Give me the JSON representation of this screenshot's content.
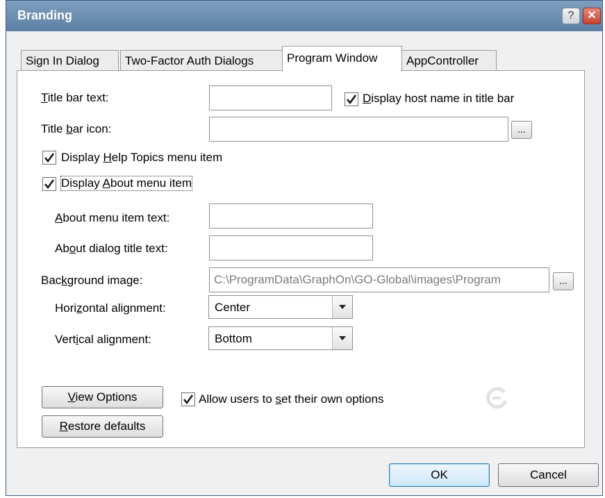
{
  "dialog": {
    "title": "Branding",
    "help_glyph": "?",
    "close_glyph": "✕"
  },
  "tabs": [
    {
      "label": "Sign In Dialog"
    },
    {
      "label": "Two-Factor Auth Dialogs"
    },
    {
      "label": "Program Window",
      "active": true
    },
    {
      "label": "AppController"
    }
  ],
  "form": {
    "title_bar_text": {
      "pre": "",
      "u": "T",
      "post": "itle bar text:",
      "value": ""
    },
    "display_host_name": {
      "pre": "",
      "u": "D",
      "post": "isplay host name in title bar",
      "checked": true
    },
    "title_bar_icon": {
      "pre": "Title ",
      "u": "b",
      "post": "ar icon:",
      "value": ""
    },
    "browse_label": "...",
    "display_help_topics": {
      "pre": "Display ",
      "u": "H",
      "post": "elp Topics menu item",
      "checked": true
    },
    "display_about": {
      "pre": "Display ",
      "u": "A",
      "post": "bout menu item",
      "checked": true
    },
    "about_menu_item_text": {
      "pre": "",
      "u": "A",
      "post": "bout menu item text:",
      "value": ""
    },
    "about_dialog_title_text": {
      "pre": "Ab",
      "u": "o",
      "post": "ut dialog title text:",
      "value": ""
    },
    "background_image": {
      "pre": "Bac",
      "u": "k",
      "post": "ground image:",
      "value": "C:\\ProgramData\\GraphOn\\GO-Global\\images\\Program"
    },
    "horizontal_alignment": {
      "pre": "Hori",
      "u": "z",
      "post": "ontal alignment:",
      "value": "Center"
    },
    "vertical_alignment": {
      "pre": "Vert",
      "u": "i",
      "post": "cal alignment:",
      "value": "Bottom"
    },
    "view_options": {
      "pre": "",
      "u": "V",
      "post": "iew Options"
    },
    "allow_users": {
      "pre": "Allow users to ",
      "u": "s",
      "post": "et their own options",
      "checked": true
    },
    "restore_defaults": {
      "pre": "",
      "u": "R",
      "post": "estore defaults"
    }
  },
  "footer": {
    "ok": "OK",
    "cancel": "Cancel"
  },
  "icons": {
    "checkmark": "checkmark-icon",
    "dropdown": "chevron-down-icon",
    "logo": "graphon-logo-icon"
  },
  "colors": {
    "titlebar": "#6d8fb3",
    "accent_button": "#3c7fb1"
  }
}
